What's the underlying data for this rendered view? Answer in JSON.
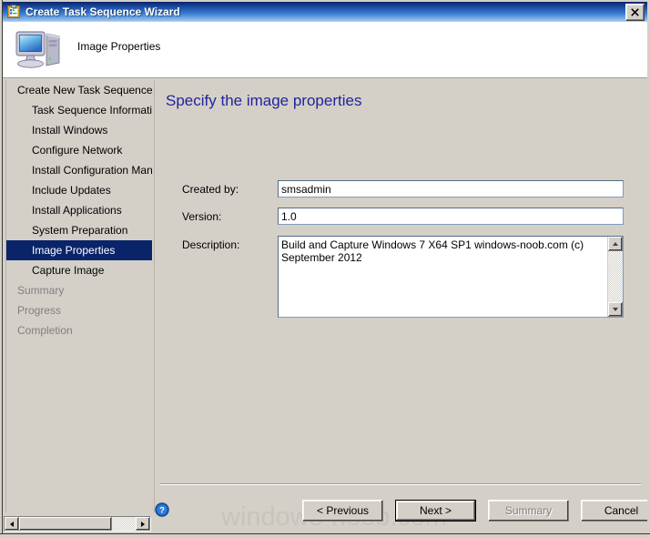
{
  "window": {
    "title": "Create Task Sequence Wizard",
    "title_icon": "task-sequence-clipboard-icon",
    "close_label": "✕"
  },
  "banner": {
    "icon": "computer-monitor-icon",
    "title": "Image Properties"
  },
  "sidebar": {
    "items": [
      {
        "label": "Create New Task Sequence",
        "level": 0,
        "state": "normal"
      },
      {
        "label": "Task Sequence Information",
        "level": 1,
        "state": "normal"
      },
      {
        "label": "Install Windows",
        "level": 1,
        "state": "normal"
      },
      {
        "label": "Configure Network",
        "level": 1,
        "state": "normal"
      },
      {
        "label": "Install Configuration Manag",
        "level": 1,
        "state": "normal"
      },
      {
        "label": "Include Updates",
        "level": 1,
        "state": "normal"
      },
      {
        "label": "Install Applications",
        "level": 1,
        "state": "normal"
      },
      {
        "label": "System Preparation",
        "level": 1,
        "state": "normal"
      },
      {
        "label": "Image Properties",
        "level": 1,
        "state": "selected"
      },
      {
        "label": "Capture Image",
        "level": 1,
        "state": "normal"
      },
      {
        "label": "Summary",
        "level": 0,
        "state": "dim"
      },
      {
        "label": "Progress",
        "level": 0,
        "state": "dim"
      },
      {
        "label": "Completion",
        "level": 0,
        "state": "dim"
      }
    ]
  },
  "content": {
    "heading": "Specify the image properties",
    "fields": {
      "created_by_label": "Created by:",
      "created_by_value": "smsadmin",
      "version_label": "Version:",
      "version_value": "1.0",
      "description_label": "Description:",
      "description_value": "Build and Capture Windows 7 X64 SP1 windows-noob.com (c) September 2012"
    }
  },
  "footer": {
    "help_icon": "help-question-icon",
    "buttons": [
      {
        "label": "< Previous",
        "state": "normal"
      },
      {
        "label": "Next >",
        "state": "default"
      },
      {
        "label": "Summary",
        "state": "disabled"
      },
      {
        "label": "Cancel",
        "state": "normal"
      }
    ]
  },
  "watermark": {
    "text": "windows-noob.com"
  },
  "scrollbars": {
    "horizontal_left_arrow": "arrow-left-icon",
    "horizontal_right_arrow": "arrow-right-icon",
    "description_up_arrow": "arrow-up-icon",
    "description_down_arrow": "arrow-down-icon"
  },
  "colors": {
    "titlebar_start": "#0a246a",
    "titlebar_end": "#c9e0f6",
    "face": "#d4d0c8",
    "selection": "#0a246a",
    "heading": "#21259c",
    "watermark": "#c8c4bc"
  }
}
